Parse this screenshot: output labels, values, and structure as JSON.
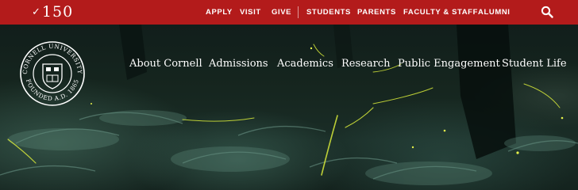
{
  "anniversary_logo": {
    "text": "150",
    "swash": "✓"
  },
  "top_nav": {
    "apply": "APPLY",
    "visit": "VISIT",
    "give": "GIVE",
    "students": "STUDENTS",
    "parents": "PARENTS",
    "faculty_staff": "FACULTY & STAFF",
    "alumni": "ALUMNI",
    "search_icon": "search-icon"
  },
  "seal": {
    "ring_text": "CORNELL UNIVERSITY · FOUNDED A.D. 1865"
  },
  "main_nav": {
    "about": "About Cornell",
    "admissions": "Admissions",
    "academics": "Academics",
    "research": "Research",
    "public_engagement": "Public Engagement",
    "student_life": "Student Life"
  },
  "colors": {
    "brand_red": "#b31b1b",
    "firefly": "#d8ea3a"
  }
}
